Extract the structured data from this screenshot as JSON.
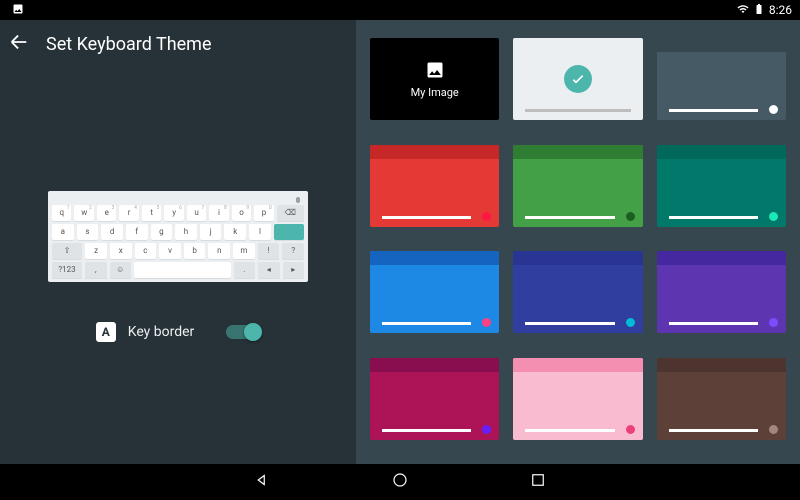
{
  "status": {
    "time": "8:26"
  },
  "header": {
    "title": "Set Keyboard Theme"
  },
  "toggle": {
    "label": "Key border",
    "icon_letter": "A",
    "on": true
  },
  "themes": {
    "my_image_label": "My Image",
    "selected_index": 1
  },
  "keyboard_rows": {
    "r1": [
      "q",
      "w",
      "e",
      "r",
      "t",
      "y",
      "u",
      "i",
      "o",
      "p"
    ],
    "r1_hints": [
      "1",
      "2",
      "3",
      "4",
      "5",
      "6",
      "7",
      "8",
      "9",
      "0"
    ],
    "r2": [
      "a",
      "s",
      "d",
      "f",
      "g",
      "h",
      "j",
      "k",
      "l"
    ],
    "r3": [
      "z",
      "x",
      "c",
      "v",
      "b",
      "n",
      "m"
    ],
    "r4_left": "?123",
    "r4_comma": ",",
    "r4_period": "."
  }
}
